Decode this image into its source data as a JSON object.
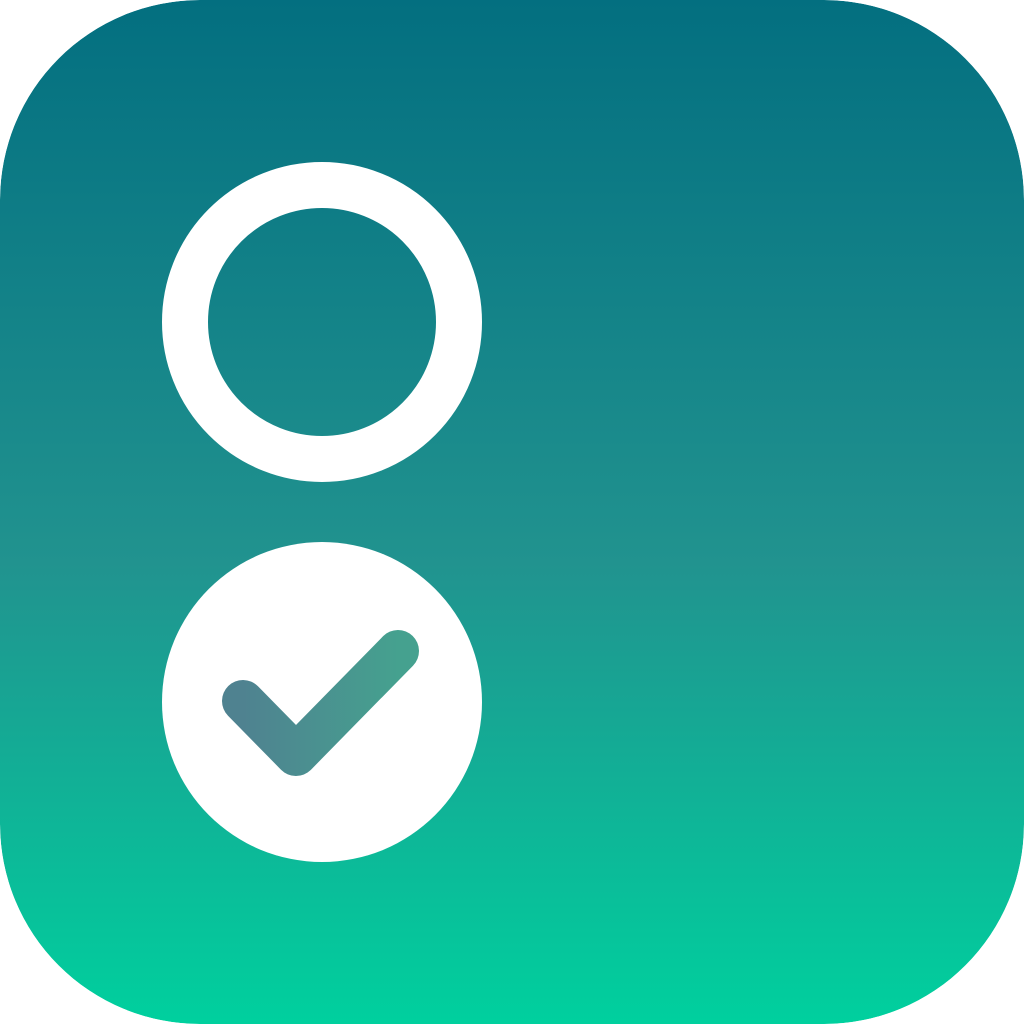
{
  "icon": {
    "semantic": "task-checklist-app-icon",
    "background": {
      "gradient_top": "#036F80",
      "gradient_mid": "#21938F",
      "gradient_bottom": "#00D09E"
    },
    "items": [
      {
        "icon_name": "unchecked-circle-icon",
        "checked": false,
        "color": "#FFFFFF"
      },
      {
        "icon_name": "checked-circle-icon",
        "checked": true,
        "color": "#FFFFFF"
      }
    ],
    "checkmark": {
      "icon_name": "checkmark-icon",
      "gradient_start": "#4F8290",
      "gradient_end": "#45A18F"
    }
  }
}
